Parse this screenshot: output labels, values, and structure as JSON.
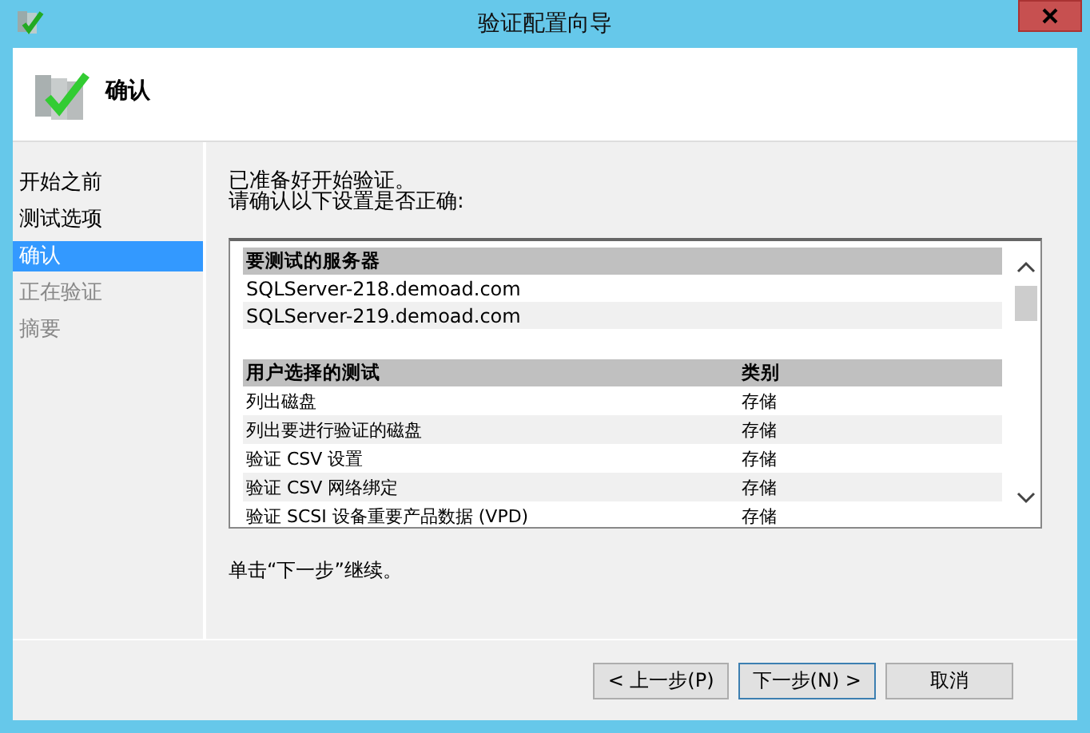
{
  "window": {
    "title": "验证配置向导"
  },
  "header": {
    "title": "确认"
  },
  "sidebar": {
    "items": [
      {
        "label": "开始之前",
        "selected": false,
        "disabled": false
      },
      {
        "label": "测试选项",
        "selected": false,
        "disabled": false
      },
      {
        "label": "确认",
        "selected": true,
        "disabled": false
      },
      {
        "label": "正在验证",
        "selected": false,
        "disabled": true
      },
      {
        "label": "摘要",
        "selected": false,
        "disabled": true
      }
    ]
  },
  "intro": [
    "已准备好开始验证。",
    "请确认以下设置是否正确:"
  ],
  "servers": {
    "heading": "要测试的服务器",
    "rows": [
      "SQLServer-218.demoad.com",
      "SQLServer-219.demoad.com"
    ]
  },
  "tests": {
    "columns": [
      "用户选择的测试",
      "类别"
    ],
    "rows": [
      [
        "列出磁盘",
        "存储"
      ],
      [
        "列出要进行验证的磁盘",
        "存储"
      ],
      [
        "验证 CSV 设置",
        "存储"
      ],
      [
        "验证 CSV 网络绑定",
        "存储"
      ],
      [
        "验证 SCSI 设备重要产品数据 (VPD)",
        "存储"
      ]
    ]
  },
  "hint": "单击“下一步”继续。",
  "buttons": [
    "< 上一步(P)",
    "下一步(N) >",
    "取消"
  ]
}
